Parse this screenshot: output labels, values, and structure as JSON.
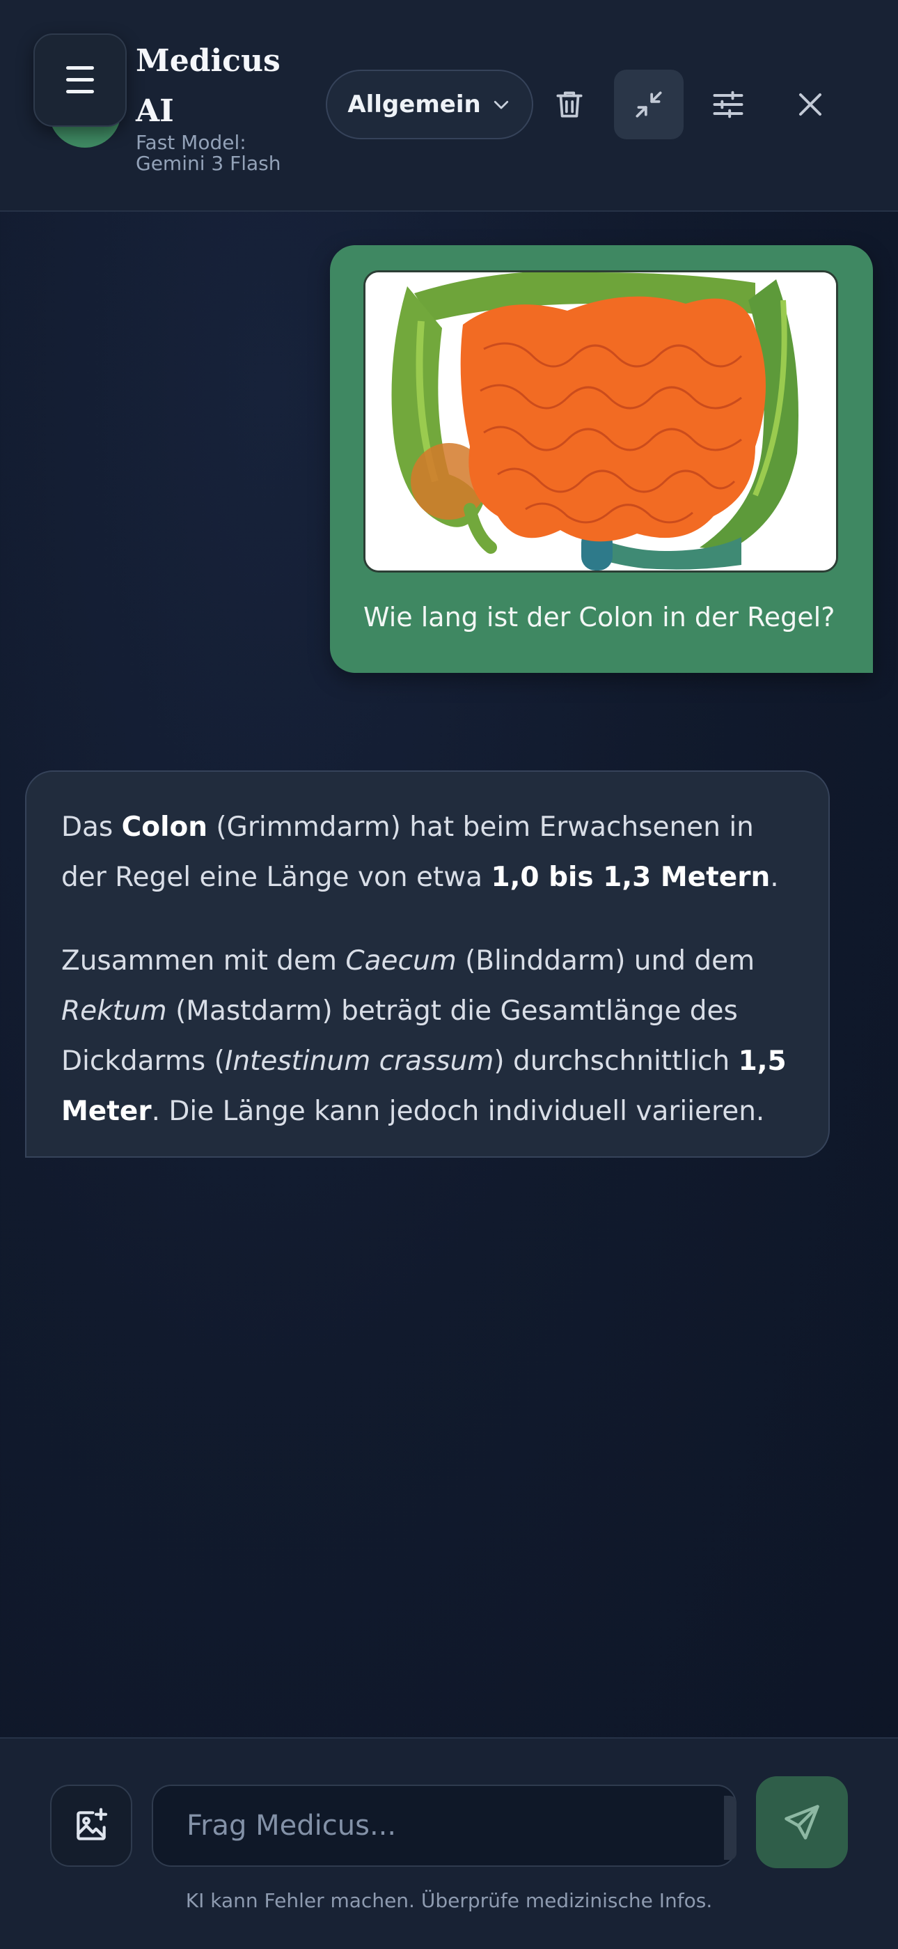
{
  "header": {
    "title": "Medicus AI",
    "subtitle": "Fast Model: Gemini 3 Flash",
    "mode_label": "Allgemein",
    "icons": {
      "menu": "hamburger-menu-icon",
      "mode": "chevron-down-icon",
      "delete": "trash-icon",
      "minimize": "minimize-icon",
      "settings": "sliders-icon",
      "close": "close-icon"
    }
  },
  "messages": {
    "user": {
      "image": "large-intestine-illustration",
      "text": "Wie lang ist der Colon in der Regel?"
    },
    "assistant": {
      "p1_a": "Das ",
      "p1_b": "Colon",
      "p1_c": " (Grimmdarm) hat beim Erwachsenen in der Regel eine Länge von etwa ",
      "p1_d": "1,0 bis 1,3 Metern",
      "p1_e": ".",
      "p2_a": "Zusammen mit dem ",
      "p2_b": "Caecum",
      "p2_c": " (Blinddarm) und dem ",
      "p2_d": "Rektum",
      "p2_e": " (Mastdarm) beträgt die Gesamtlänge des Dickdarms (",
      "p2_f": "Intestinum crassum",
      "p2_g": ") durchschnittlich ",
      "p2_h": "1,5 Meter",
      "p2_i": ". Die Länge kann jedoch individuell variieren."
    }
  },
  "composer": {
    "placeholder": "Frag Medicus...",
    "disclaimer": "KI kann Fehler machen. Überprüfe medizinische Infos.",
    "icons": {
      "attach": "image-upload-icon",
      "send": "send-icon"
    }
  },
  "colors": {
    "background": "#111a2d",
    "header": "#182234",
    "user_bubble": "#3f8862",
    "ai_bubble": "#212c3d",
    "send_button": "#2f5e49"
  }
}
